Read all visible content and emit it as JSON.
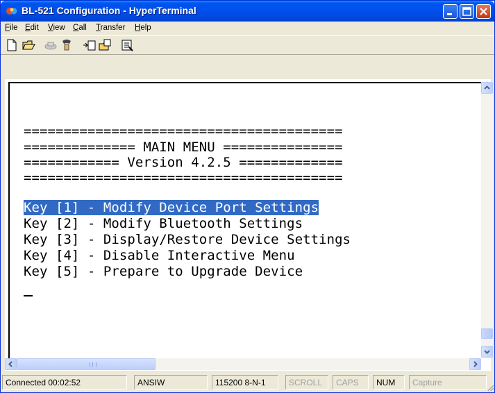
{
  "window": {
    "title": "BL-521 Configuration - HyperTerminal"
  },
  "menu": [
    {
      "underline": "F",
      "rest": "ile"
    },
    {
      "underline": "E",
      "rest": "dit"
    },
    {
      "underline": "V",
      "rest": "iew"
    },
    {
      "underline": "C",
      "rest": "all"
    },
    {
      "underline": "T",
      "rest": "ransfer"
    },
    {
      "underline": "H",
      "rest": "elp"
    }
  ],
  "terminal": {
    "lines": [
      "========================================",
      "============== MAIN MENU ===============",
      "============ Version 4.2.5 =============",
      "========================================",
      "",
      "Key [1] - Modify Device Port Settings",
      "Key [2] - Modify Bluetooth Settings",
      "Key [3] - Display/Restore Device Settings",
      "Key [4] - Disable Interactive Menu",
      "Key [5] - Prepare to Upgrade Device"
    ],
    "selected_line_index": 5
  },
  "status": {
    "connected": "Connected 00:02:52",
    "emulation": "ANSIW",
    "port_settings": "115200 8-N-1",
    "scroll": "SCROLL",
    "caps": "CAPS",
    "num": "NUM",
    "capture": "Capture"
  },
  "icons": [
    "app-icon",
    "minimize-icon",
    "maximize-icon",
    "close-icon",
    "new-icon",
    "open-icon",
    "disconnect-icon",
    "connect-icon",
    "send-icon",
    "receive-icon",
    "properties-icon"
  ]
}
